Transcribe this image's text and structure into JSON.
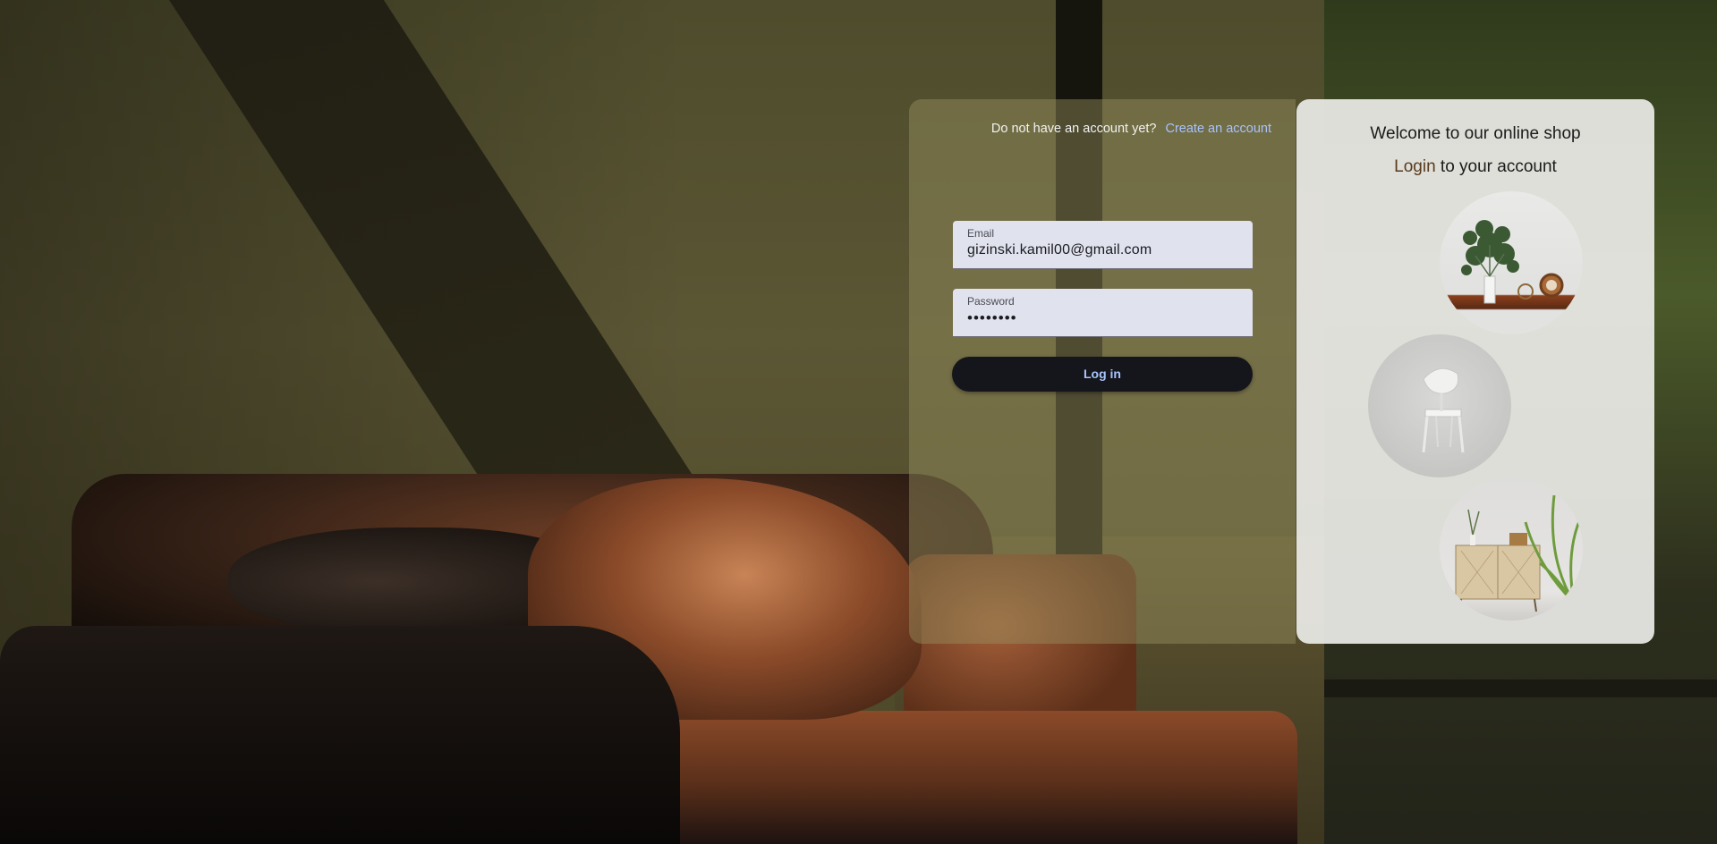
{
  "signup": {
    "prompt": "Do not have an account yet?",
    "link": "Create an account"
  },
  "form": {
    "email_label": "Email",
    "email_value": "gizinski.kamil00@gmail.com",
    "password_label": "Password",
    "password_value": "••••••••",
    "login_button": "Log in"
  },
  "welcome": {
    "title": "Welcome to our online shop",
    "subtitle_accent": "Login",
    "subtitle_rest": " to your account"
  },
  "colors": {
    "accent_link": "#a8c2ff",
    "button_bg": "#15161b",
    "field_bg": "#e0e2ed"
  }
}
